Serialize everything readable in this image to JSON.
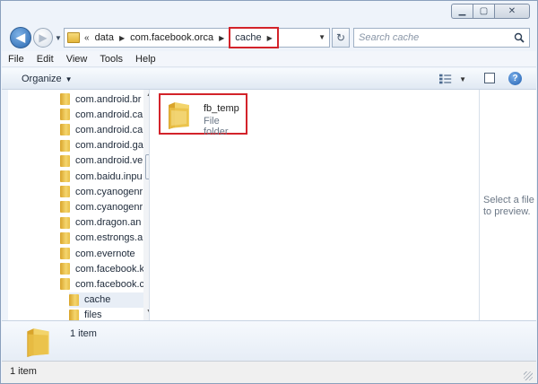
{
  "window": {
    "minimize_glyph": "▁",
    "maximize_glyph": "▢",
    "close_glyph": "✕"
  },
  "navigation": {
    "back_glyph": "◀",
    "forward_glyph": "▶",
    "history_glyph": "▼"
  },
  "address": {
    "overflow_glyph": "«",
    "separator_glyph": "▶",
    "crumbs": [
      "data",
      "com.facebook.orca"
    ],
    "current": "cache",
    "dropdown_glyph": "▼",
    "refresh_glyph": "↻"
  },
  "search": {
    "placeholder": "Search cache"
  },
  "menu": [
    "File",
    "Edit",
    "View",
    "Tools",
    "Help"
  ],
  "commands": {
    "organize": "Organize",
    "dropdown_glyph": "▼",
    "view_dropdown_glyph": "▼",
    "help_glyph": "?"
  },
  "tree": {
    "items": [
      {
        "label": "com.android.br",
        "indent": 0
      },
      {
        "label": "com.android.ca",
        "indent": 0
      },
      {
        "label": "com.android.ca",
        "indent": 0
      },
      {
        "label": "com.android.ga",
        "indent": 0
      },
      {
        "label": "com.android.ve",
        "indent": 0
      },
      {
        "label": "com.baidu.inpu",
        "indent": 0
      },
      {
        "label": "com.cyanogenr",
        "indent": 0
      },
      {
        "label": "com.cyanogenr",
        "indent": 0
      },
      {
        "label": "com.dragon.an",
        "indent": 0
      },
      {
        "label": "com.estrongs.a",
        "indent": 0
      },
      {
        "label": "com.evernote",
        "indent": 0
      },
      {
        "label": "com.facebook.k",
        "indent": 0
      },
      {
        "label": "com.facebook.c",
        "indent": 0
      },
      {
        "label": "cache",
        "indent": 1,
        "selected": true
      },
      {
        "label": "files",
        "indent": 1
      }
    ],
    "scroll_up_glyph": "▲",
    "scroll_down_glyph": "▼"
  },
  "content": {
    "item": {
      "name": "fb_temp",
      "type": "File folder"
    }
  },
  "preview": {
    "message": "Select a file\nto preview."
  },
  "details": {
    "count": "1 item"
  },
  "status": {
    "text": "1 item"
  },
  "colors": {
    "highlight": "#d3232a",
    "folder": "#e8be45"
  }
}
